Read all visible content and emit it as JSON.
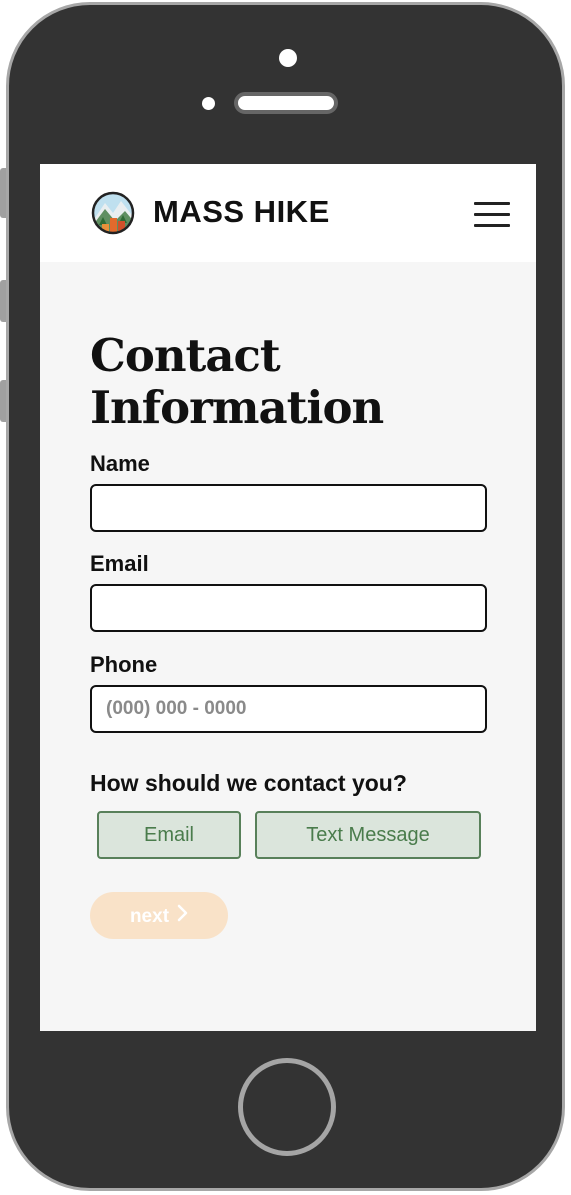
{
  "header": {
    "brand": "MASS HIKE",
    "logo_icon": "mountain-logo-icon",
    "menu_icon": "hamburger-menu-icon"
  },
  "page": {
    "title_line1": "Contact",
    "title_line2": "Information"
  },
  "form": {
    "name_label": "Name",
    "name_value": "",
    "email_label": "Email",
    "email_value": "",
    "phone_label": "Phone",
    "phone_placeholder": "(000) 000 - 0000",
    "phone_value": "",
    "contact_question": "How should we contact you?",
    "contact_options": [
      "Email",
      "Text Message"
    ],
    "next_label": "next",
    "next_icon": "chevron-right-icon"
  },
  "colors": {
    "option_border": "#58805a",
    "option_bg": "#dbe5dc",
    "option_text": "#4a7c4c",
    "next_bg": "#f9e2c8"
  }
}
